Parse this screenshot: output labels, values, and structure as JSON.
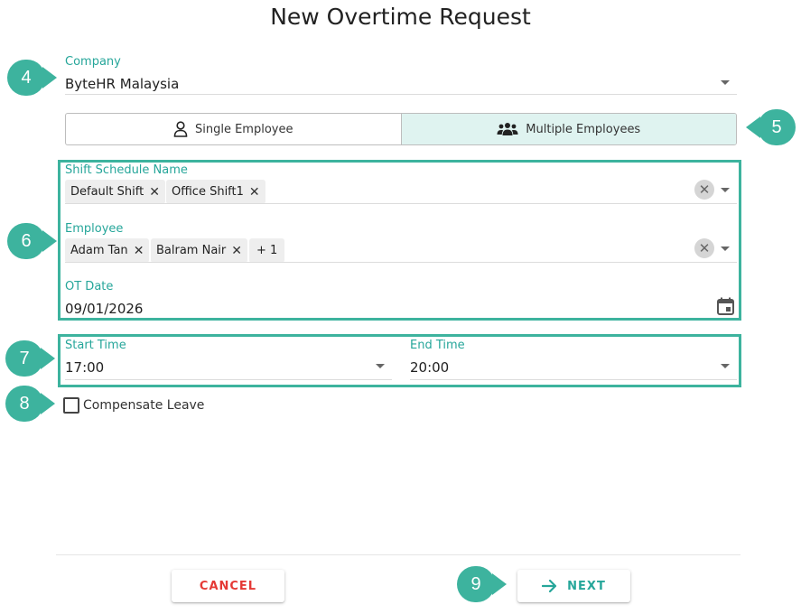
{
  "dialog": {
    "title": "New Overtime Request"
  },
  "company": {
    "label": "Company",
    "value": "ByteHR Malaysia"
  },
  "mode_toggle": {
    "single_label": "Single Employee",
    "multiple_label": "Multiple Employees",
    "selected": "Multiple Employees"
  },
  "shift_schedule": {
    "label": "Shift Schedule Name",
    "chips": [
      "Default Shift",
      "Office Shift1"
    ]
  },
  "employee": {
    "label": "Employee",
    "chips": [
      "Adam Tan",
      "Balram Nair"
    ],
    "more": "+ 1"
  },
  "ot_date": {
    "label": "OT Date",
    "value": "09/01/2026"
  },
  "start_time": {
    "label": "Start Time",
    "value": "17:00"
  },
  "end_time": {
    "label": "End Time",
    "value": "20:00"
  },
  "compensate_leave": {
    "label": "Compensate Leave",
    "checked": false
  },
  "footer": {
    "cancel_label": "CANCEL",
    "next_label": "NEXT"
  },
  "badges": {
    "b4": "4",
    "b5": "5",
    "b6": "6",
    "b7": "7",
    "b8": "8",
    "b9": "9"
  },
  "colors": {
    "accent": "#26a69a",
    "badge": "#3db39e",
    "cancel": "#e53935",
    "toggle_active": "#dff3f0"
  },
  "icons": {
    "single": "person-icon",
    "multiple": "group-icon",
    "calendar": "calendar-icon",
    "next": "arrow-right-icon"
  }
}
